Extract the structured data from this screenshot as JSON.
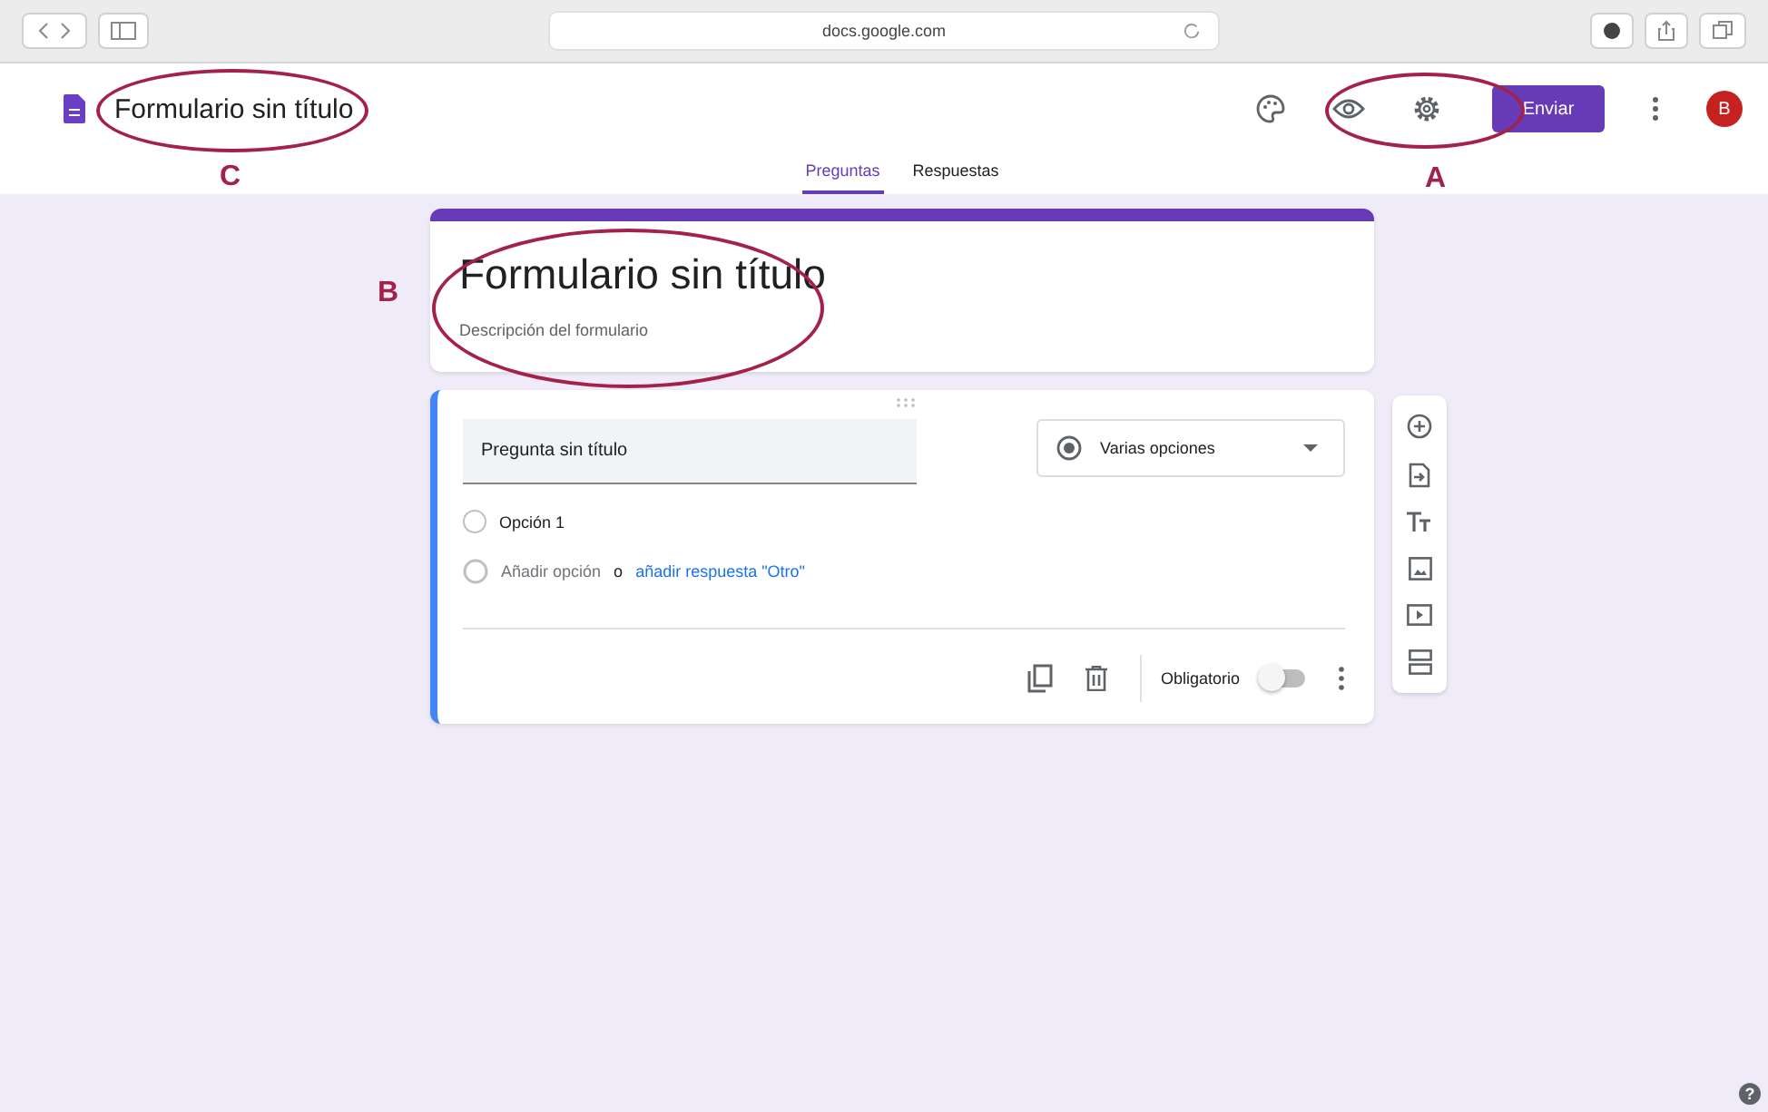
{
  "browser": {
    "url": "docs.google.com"
  },
  "header": {
    "title": "Formulario sin título",
    "send_button": "Enviar",
    "avatar": "B"
  },
  "tabs": [
    {
      "label": "Preguntas",
      "selected": true
    },
    {
      "label": "Respuestas",
      "selected": false
    }
  ],
  "form": {
    "title": "Formulario sin título",
    "description": "Descripción del formulario"
  },
  "question": {
    "title": "Pregunta sin título",
    "type": "Varias opciones",
    "options": [
      {
        "label": "Opción 1",
        "selected": false
      }
    ],
    "add_option": "Añadir opción",
    "or": "o",
    "add_other": "añadir respuesta \"Otro\"",
    "required": {
      "label": "Obligatorio",
      "on": false
    }
  },
  "annotations": [
    {
      "letter": "C"
    },
    {
      "letter": "A"
    },
    {
      "letter": "B"
    }
  ],
  "help": "?"
}
